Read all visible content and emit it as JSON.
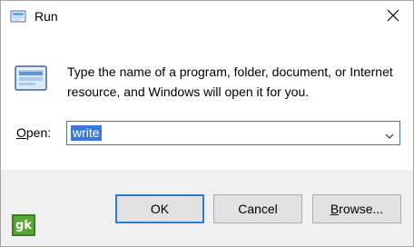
{
  "window": {
    "title": "Run",
    "title_icon": "run-app-icon",
    "close_icon": "close-icon"
  },
  "body": {
    "icon": "run-app-icon",
    "message": "Type the name of a program, folder, document, or Internet resource, and Windows will open it for you."
  },
  "open_field": {
    "label_prefix": "",
    "label_access_key": "O",
    "label_rest": "pen:",
    "value": "write",
    "dropdown_icon": "chevron-down-icon"
  },
  "buttons": {
    "ok": "OK",
    "cancel": "Cancel",
    "browse_prefix": "",
    "browse_access_key": "B",
    "browse_rest": "rowse..."
  },
  "watermark": {
    "logo_text": "gk"
  },
  "colors": {
    "accent": "#3078d6",
    "selection": "#3a78d7",
    "footer_bg": "#f0f0f0",
    "button_bg": "#e1e1e1"
  }
}
